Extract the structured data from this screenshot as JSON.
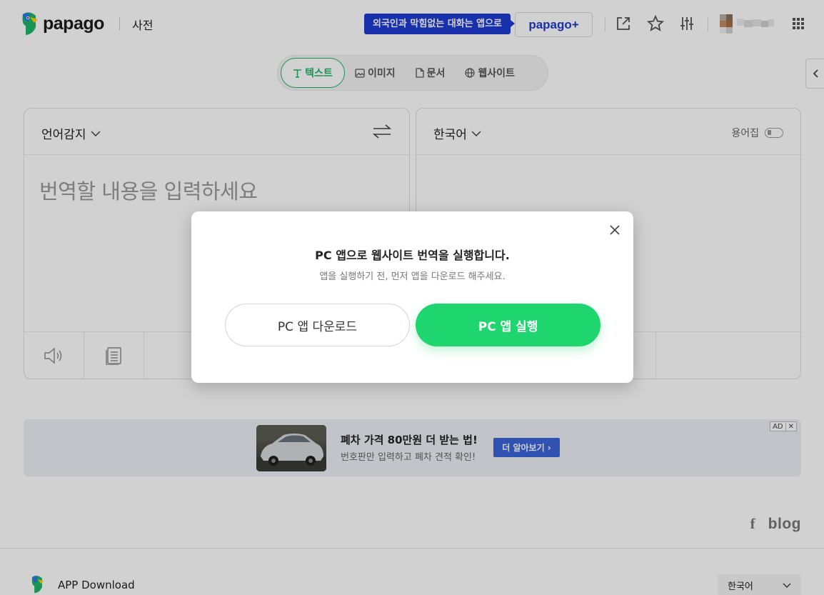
{
  "header": {
    "logo_text": "papago",
    "dictionary_link": "사전",
    "promo_text": "외국인과 막힘없는 대화는 앱으로",
    "papago_plus_label": "papago+"
  },
  "tabs": [
    {
      "label": "텍스트",
      "icon": "text-icon",
      "active": true
    },
    {
      "label": "이미지",
      "icon": "image-icon",
      "active": false
    },
    {
      "label": "문서",
      "icon": "document-icon",
      "active": false
    },
    {
      "label": "웹사이트",
      "icon": "globe-icon",
      "active": false
    }
  ],
  "source_panel": {
    "language": "언어감지",
    "placeholder": "번역할 내용을 입력하세요"
  },
  "target_panel": {
    "language": "한국어",
    "glossary_label": "용어집"
  },
  "ad": {
    "title": "폐차 가격 80만원 더 받는 법!",
    "subtitle": "번호판만 입력하고 폐차 견적 확인!",
    "button_label": "더 알아보기 ›",
    "badge": "AD"
  },
  "social": {
    "facebook": "f",
    "blog": "blog"
  },
  "footer": {
    "app_download": "APP Download",
    "language_select": "한국어"
  },
  "modal": {
    "title": "PC 앱으로 웹사이트 번역을 실행합니다.",
    "subtitle": "앱을 실행하기 전, 먼저 앱을 다운로드 해주세요.",
    "download_button": "PC 앱 다운로드",
    "run_button": "PC 앱 실행"
  },
  "colors": {
    "brand_green": "#1fd66e",
    "tab_green": "#1fb56a",
    "promo_blue": "#1e3bd1",
    "ad_button_blue": "#3b64db"
  }
}
